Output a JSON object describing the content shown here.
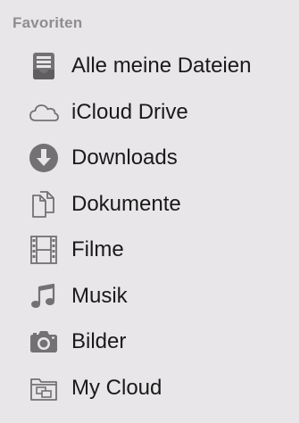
{
  "colors": {
    "background": "#e8e6e8",
    "section_title": "#8f8d8f",
    "item_label": "#1a1a1a",
    "icon": "#727072"
  },
  "sidebar": {
    "section_title": "Favoriten",
    "items": [
      {
        "label": "Alle meine Dateien",
        "icon": "all-files-icon"
      },
      {
        "label": "iCloud Drive",
        "icon": "cloud-icon"
      },
      {
        "label": "Downloads",
        "icon": "download-icon"
      },
      {
        "label": "Dokumente",
        "icon": "documents-icon"
      },
      {
        "label": "Filme",
        "icon": "film-icon"
      },
      {
        "label": "Musik",
        "icon": "music-note-icon"
      },
      {
        "label": "Bilder",
        "icon": "camera-icon"
      },
      {
        "label": "My Cloud",
        "icon": "network-folder-icon"
      }
    ]
  }
}
